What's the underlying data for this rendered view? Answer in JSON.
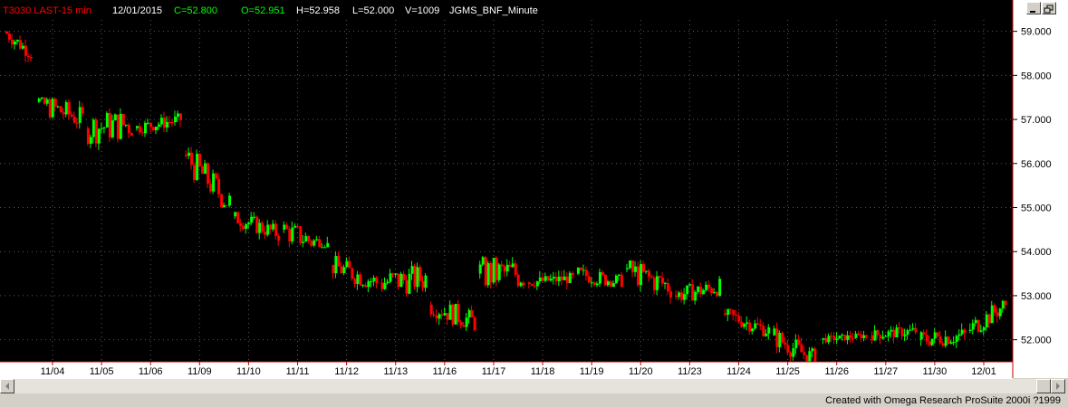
{
  "header": {
    "symbol": "T3030 LAST-15 min",
    "date": "12/01/2015",
    "close": "C=52.800",
    "open": "O=52.951",
    "high": "H=52.958",
    "low": "L=52.000",
    "volume": "V=1009",
    "dataset": "JGMS_BNF_Minute"
  },
  "footer": {
    "credit": "Created with Omega Research ProSuite 2000i ?1999"
  },
  "colors": {
    "background": "#000000",
    "up": "#00ff00",
    "down": "#ff0000",
    "grid": "#5a5a5a",
    "axis": "#c00000",
    "symbol_text": "#ff0000",
    "close_text": "#00ff00"
  },
  "chart_data": {
    "type": "candlestick",
    "title": "",
    "xlabel": "",
    "ylabel": "",
    "ylim": [
      51.5,
      59.3
    ],
    "y_ticks": [
      "59.000",
      "58.000",
      "57.000",
      "56.000",
      "55.000",
      "54.000",
      "53.000",
      "52.000"
    ],
    "y_tick_values": [
      59,
      58,
      57,
      56,
      55,
      54,
      53,
      52
    ],
    "categories": [
      "11/04",
      "11/05",
      "11/06",
      "11/09",
      "11/10",
      "11/11",
      "11/12",
      "11/13",
      "11/16",
      "11/17",
      "11/18",
      "11/19",
      "11/20",
      "11/23",
      "11/24",
      "11/25",
      "11/26",
      "11/27",
      "11/30",
      "12/01"
    ],
    "grid": true,
    "series": [
      {
        "values": [
          {
            "x": "11/03",
            "o": 59.0,
            "h": 59.0,
            "l": 58.3,
            "c": 58.5
          },
          {
            "x": "11/04",
            "o": 57.4,
            "h": 57.5,
            "l": 56.4,
            "c": 57.0
          },
          {
            "x": "11/05",
            "o": 56.8,
            "h": 57.3,
            "l": 55.8,
            "c": 56.9
          },
          {
            "x": "11/06",
            "o": 56.8,
            "h": 57.2,
            "l": 56.6,
            "c": 57.0
          },
          {
            "x": "11/09",
            "o": 56.2,
            "h": 56.4,
            "l": 55.0,
            "c": 55.1
          },
          {
            "x": "11/10",
            "o": 54.8,
            "h": 54.9,
            "l": 54.1,
            "c": 54.4
          },
          {
            "x": "11/11",
            "o": 54.5,
            "h": 55.2,
            "l": 54.1,
            "c": 54.1
          },
          {
            "x": "11/12",
            "o": 53.7,
            "h": 54.0,
            "l": 53.0,
            "c": 53.3
          },
          {
            "x": "11/13",
            "o": 53.3,
            "h": 53.9,
            "l": 52.6,
            "c": 53.4
          },
          {
            "x": "11/16",
            "o": 52.8,
            "h": 53.2,
            "l": 52.2,
            "c": 52.4
          },
          {
            "x": "11/17",
            "o": 53.5,
            "h": 53.9,
            "l": 52.3,
            "c": 53.5
          },
          {
            "x": "11/18",
            "o": 53.3,
            "h": 53.6,
            "l": 53.1,
            "c": 53.4
          },
          {
            "x": "11/19",
            "o": 53.5,
            "h": 53.9,
            "l": 53.2,
            "c": 53.3
          },
          {
            "x": "11/20",
            "o": 53.6,
            "h": 53.8,
            "l": 52.6,
            "c": 53.2
          },
          {
            "x": "11/23",
            "o": 53.0,
            "h": 53.6,
            "l": 52.8,
            "c": 53.2
          },
          {
            "x": "11/24",
            "o": 52.6,
            "h": 52.7,
            "l": 52.0,
            "c": 52.2
          },
          {
            "x": "11/25",
            "o": 52.1,
            "h": 52.5,
            "l": 51.5,
            "c": 51.5
          },
          {
            "x": "11/26",
            "o": 52.0,
            "h": 52.2,
            "l": 51.9,
            "c": 52.1
          },
          {
            "x": "11/27",
            "o": 52.1,
            "h": 52.4,
            "l": 51.9,
            "c": 52.2
          },
          {
            "x": "11/30",
            "o": 52.0,
            "h": 52.4,
            "l": 51.6,
            "c": 52.1
          },
          {
            "x": "12/01",
            "o": 52.2,
            "h": 52.9,
            "l": 52.0,
            "c": 52.8
          }
        ]
      }
    ]
  }
}
